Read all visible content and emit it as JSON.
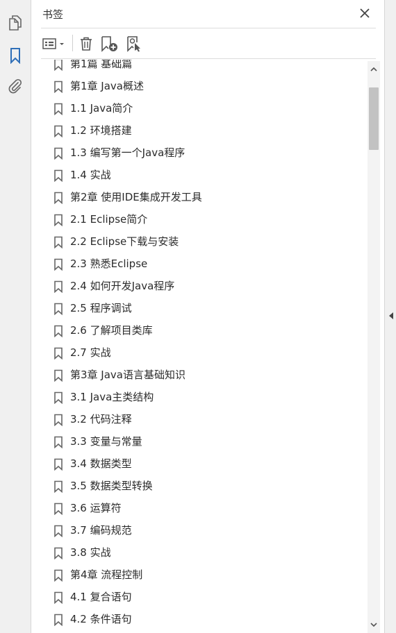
{
  "panel": {
    "title": "书签"
  },
  "icons": {
    "rail": [
      "pages-icon",
      "bookmark-icon",
      "attachment-icon"
    ],
    "toolbar": [
      "options-menu-icon",
      "delete-icon",
      "new-bookmark-icon",
      "bookmark-from-selection-icon"
    ],
    "close": "close-icon"
  },
  "colors": {
    "accent": "#2f6fb8",
    "icon_gray": "#666666"
  },
  "bookmarks": [
    "第1篇 基础篇",
    "第1章 Java概述",
    "1.1 Java简介",
    "1.2 环境搭建",
    "1.3 编写第一个Java程序",
    "1.4 实战",
    "第2章 使用IDE集成开发工具",
    "2.1 Eclipse简介",
    "2.2 Eclipse下载与安装",
    "2.3 熟悉Eclipse",
    "2.4 如何开发Java程序",
    "2.5 程序调试",
    "2.6 了解项目类库",
    "2.7 实战",
    "第3章 Java语言基础知识",
    "3.1 Java主类结构",
    "3.2 代码注释",
    "3.3 变量与常量",
    "3.4 数据类型",
    "3.5 数据类型转换",
    "3.6 运算符",
    "3.7 编码规范",
    "3.8 实战",
    "第4章 流程控制",
    "4.1 复合语句",
    "4.2 条件语句"
  ]
}
